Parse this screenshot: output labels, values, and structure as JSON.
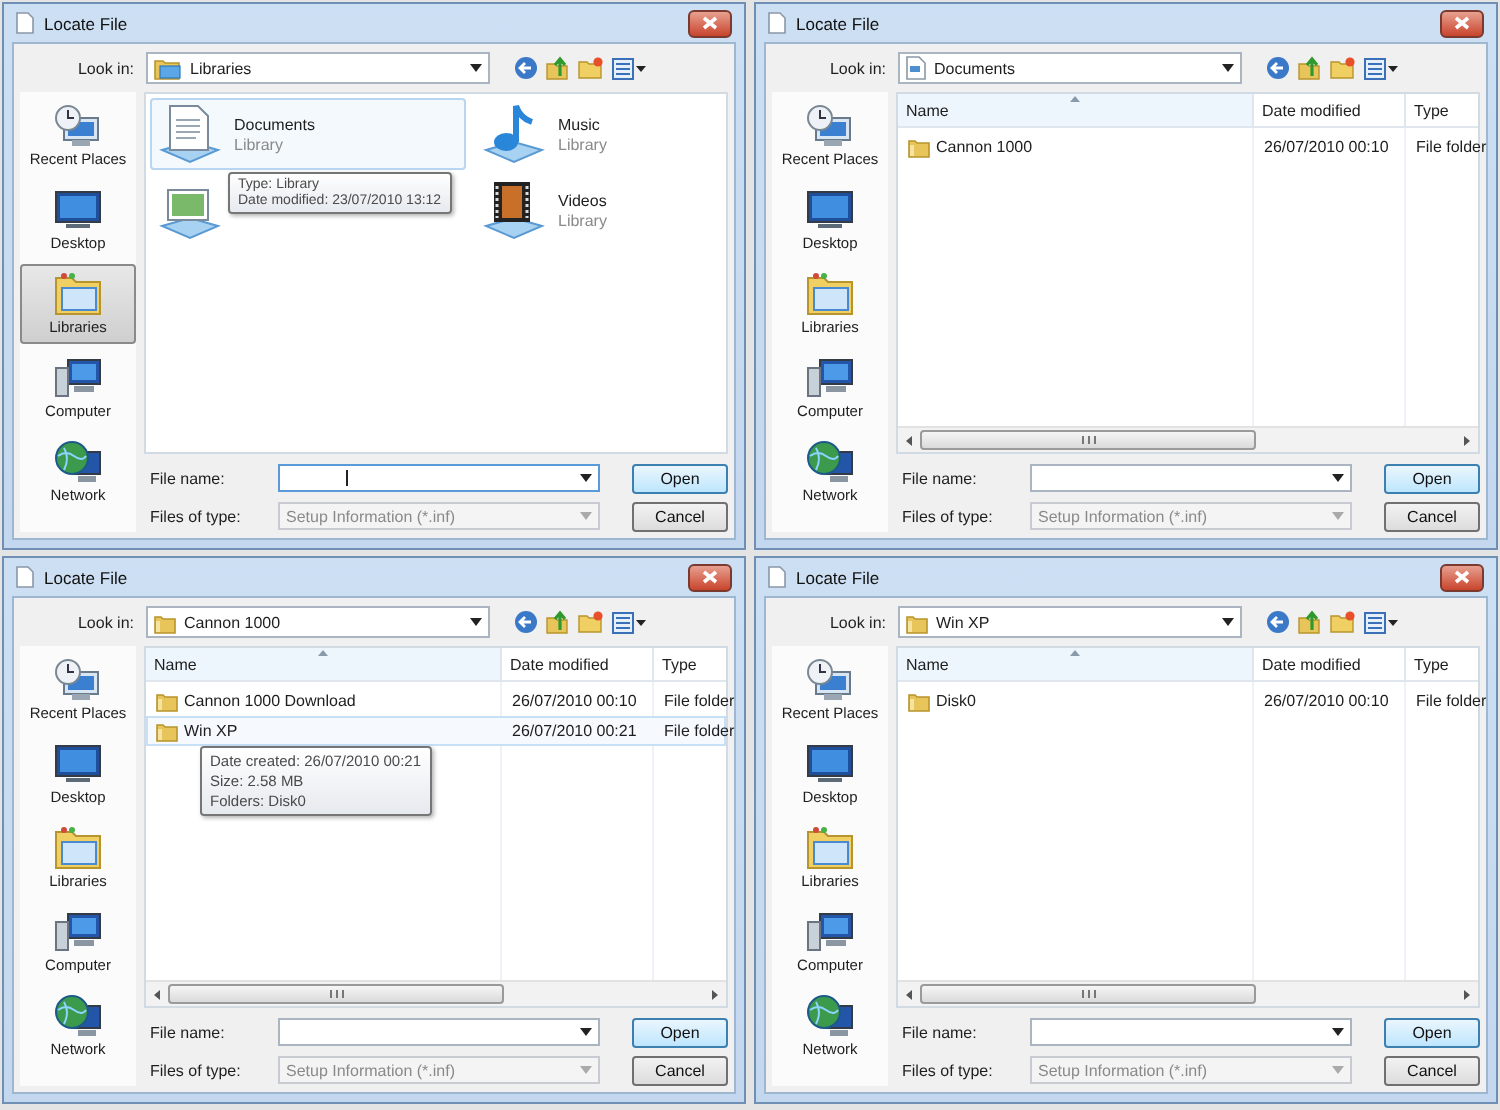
{
  "dialogs": [
    {
      "title": "Locate File",
      "look_in": {
        "label": "Look in:",
        "value": "Libraries",
        "kind": "library"
      },
      "places": [
        {
          "label": "Recent Places",
          "kind": "recent",
          "selected": false
        },
        {
          "label": "Desktop",
          "kind": "desktop",
          "selected": false
        },
        {
          "label": "Libraries",
          "kind": "libraries",
          "selected": true
        },
        {
          "label": "Computer",
          "kind": "computer",
          "selected": false
        },
        {
          "label": "Network",
          "kind": "network",
          "selected": false
        }
      ],
      "view": {
        "kind": "icons",
        "items": [
          {
            "kind": "documents",
            "name": "Documents",
            "subtitle": "Library",
            "selected": true,
            "tooltip": [
              "Type: Library",
              "Date modified: 23/07/2010 13:12"
            ]
          },
          {
            "kind": "music",
            "name": "Music",
            "subtitle": "Library",
            "selected": false
          },
          {
            "kind": "pictures",
            "selected": false
          },
          {
            "kind": "videos",
            "name": "Videos",
            "subtitle": "Library",
            "selected": false
          }
        ]
      },
      "file_name": {
        "label": "File name:",
        "focused": true
      },
      "file_type": {
        "label": "Files of type:",
        "value": "Setup Information (*.inf)"
      },
      "buttons": [
        "Open",
        "Cancel"
      ]
    },
    {
      "title": "Locate File",
      "look_in": {
        "label": "Look in:",
        "value": "Documents",
        "kind": "document"
      },
      "places": [
        {
          "label": "Recent Places",
          "kind": "recent",
          "selected": false
        },
        {
          "label": "Desktop",
          "kind": "desktop",
          "selected": false
        },
        {
          "label": "Libraries",
          "kind": "libraries",
          "selected": false
        },
        {
          "label": "Computer",
          "kind": "computer",
          "selected": false
        },
        {
          "label": "Network",
          "kind": "network",
          "selected": false
        }
      ],
      "view": {
        "kind": "details",
        "columns": [
          "Name",
          "Date modified",
          "Type"
        ],
        "rows": [
          {
            "name": "Cannon 1000",
            "date": "26/07/2010 00:10",
            "type": "File folder",
            "selected": false
          }
        ]
      },
      "file_name": {
        "label": "File name:",
        "focused": false
      },
      "file_type": {
        "label": "Files of type:",
        "value": "Setup Information (*.inf)"
      },
      "buttons": [
        "Open",
        "Cancel"
      ]
    },
    {
      "title": "Locate File",
      "look_in": {
        "label": "Look in:",
        "value": "Cannon 1000",
        "kind": "folder"
      },
      "places": [
        {
          "label": "Recent Places",
          "kind": "recent",
          "selected": false
        },
        {
          "label": "Desktop",
          "kind": "desktop",
          "selected": false
        },
        {
          "label": "Libraries",
          "kind": "libraries",
          "selected": false
        },
        {
          "label": "Computer",
          "kind": "computer",
          "selected": false
        },
        {
          "label": "Network",
          "kind": "network",
          "selected": false
        }
      ],
      "view": {
        "kind": "details",
        "columns": [
          "Name",
          "Date modified",
          "Type"
        ],
        "rows": [
          {
            "name": "Cannon 1000 Download",
            "date": "26/07/2010 00:10",
            "type": "File folder",
            "selected": false
          },
          {
            "name": "Win XP",
            "date": "26/07/2010 00:21",
            "type": "File folder",
            "selected": true,
            "tooltip": [
              "Date created: 26/07/2010 00:21",
              "Size: 2.58 MB",
              "Folders: Disk0"
            ]
          }
        ]
      },
      "file_name": {
        "label": "File name:",
        "focused": false
      },
      "file_type": {
        "label": "Files of type:",
        "value": "Setup Information (*.inf)"
      },
      "buttons": [
        "Open",
        "Cancel"
      ]
    },
    {
      "title": "Locate File",
      "look_in": {
        "label": "Look in:",
        "value": "Win XP",
        "kind": "folder"
      },
      "places": [
        {
          "label": "Recent Places",
          "kind": "recent",
          "selected": false
        },
        {
          "label": "Desktop",
          "kind": "desktop",
          "selected": false
        },
        {
          "label": "Libraries",
          "kind": "libraries",
          "selected": false
        },
        {
          "label": "Computer",
          "kind": "computer",
          "selected": false
        },
        {
          "label": "Network",
          "kind": "network",
          "selected": false
        }
      ],
      "view": {
        "kind": "details",
        "columns": [
          "Name",
          "Date modified",
          "Type"
        ],
        "rows": [
          {
            "name": "Disk0",
            "date": "26/07/2010 00:10",
            "type": "File folder",
            "selected": false
          }
        ]
      },
      "file_name": {
        "label": "File name:",
        "focused": false
      },
      "file_type": {
        "label": "Files of type:",
        "value": "Setup Information (*.inf)"
      },
      "buttons": [
        "Open",
        "Cancel"
      ]
    }
  ]
}
